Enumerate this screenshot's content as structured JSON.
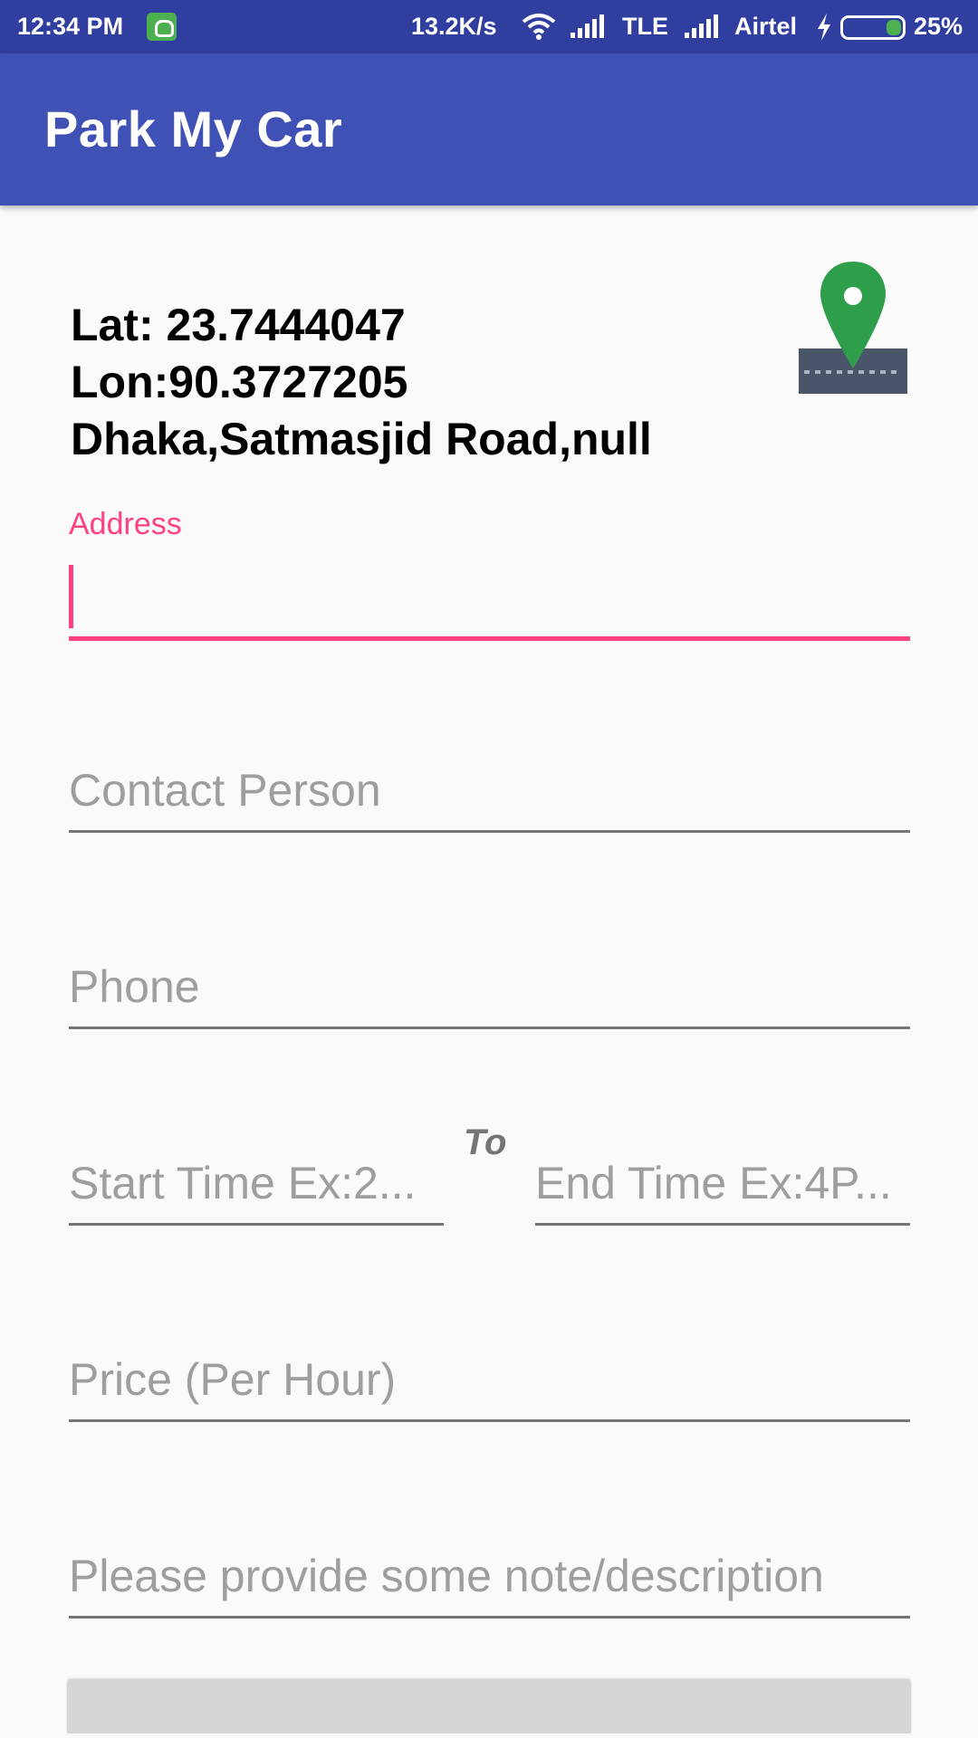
{
  "status_bar": {
    "time": "12:34 PM",
    "network_speed": "13.2K/s",
    "network_type": "TLE",
    "carrier": "Airtel",
    "battery": "25%",
    "icons": [
      "app-notification-icon",
      "wifi-icon",
      "signal-icon",
      "signal-icon",
      "charging-icon",
      "battery-icon"
    ]
  },
  "app_bar": {
    "title": "Park My Car"
  },
  "location": {
    "lat": "Lat: 23.7444047",
    "lon": "Lon:90.3727205",
    "address": "Dhaka,Satmasjid Road,null",
    "icon": "map-pin-icon"
  },
  "form": {
    "address_label": "Address",
    "address_value": "",
    "contact_placeholder": "Contact Person",
    "phone_placeholder": "Phone",
    "start_time_placeholder": "Start Time Ex:2...",
    "to_label": "To",
    "end_time_placeholder": "End Time Ex:4P...",
    "price_placeholder": "Price (Per Hour)",
    "note_placeholder": "Please provide some note/description"
  },
  "colors": {
    "status_bar": "#303f9f",
    "primary": "#3f51b5",
    "accent": "#ff4081",
    "pin": "#2e9e4a"
  }
}
